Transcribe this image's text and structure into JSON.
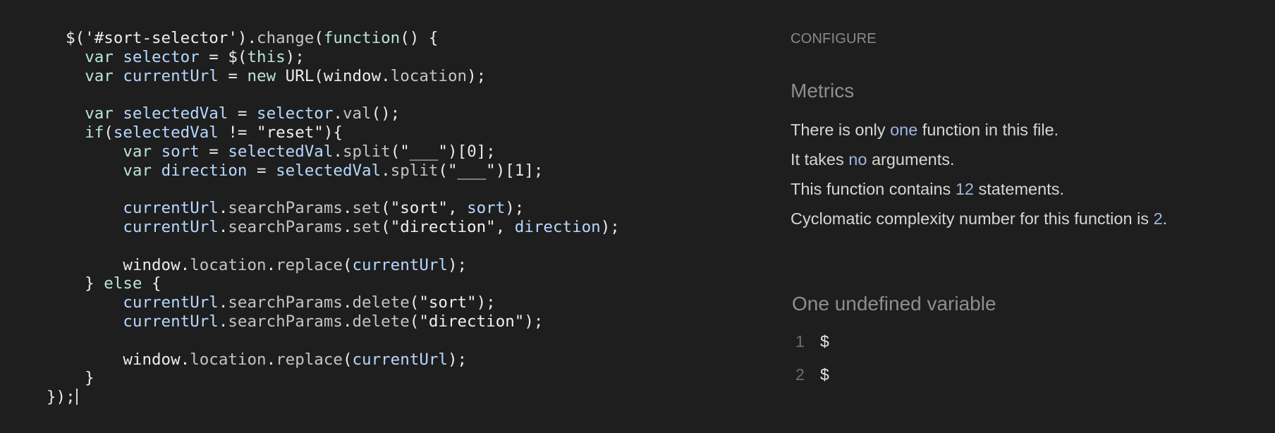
{
  "editor": {
    "lines": [
      [
        {
          "t": "  ",
          "c": "tok-default"
        },
        {
          "t": "$('#sort-selector')",
          "c": "tok-default"
        },
        {
          "t": ".",
          "c": "tok-default"
        },
        {
          "t": "change",
          "c": "tok-prop"
        },
        {
          "t": "(",
          "c": "tok-default"
        },
        {
          "t": "function",
          "c": "tok-kw"
        },
        {
          "t": "() {",
          "c": "tok-default"
        }
      ],
      [
        {
          "t": "    ",
          "c": "tok-default"
        },
        {
          "t": "var",
          "c": "tok-kw"
        },
        {
          "t": " ",
          "c": "tok-default"
        },
        {
          "t": "selector",
          "c": "tok-var"
        },
        {
          "t": " = $(",
          "c": "tok-default"
        },
        {
          "t": "this",
          "c": "tok-kw"
        },
        {
          "t": ");",
          "c": "tok-default"
        }
      ],
      [
        {
          "t": "    ",
          "c": "tok-default"
        },
        {
          "t": "var",
          "c": "tok-kw"
        },
        {
          "t": " ",
          "c": "tok-default"
        },
        {
          "t": "currentUrl",
          "c": "tok-var"
        },
        {
          "t": " = ",
          "c": "tok-default"
        },
        {
          "t": "new",
          "c": "tok-kw"
        },
        {
          "t": " URL(window.",
          "c": "tok-default"
        },
        {
          "t": "location",
          "c": "tok-prop"
        },
        {
          "t": ");",
          "c": "tok-default"
        }
      ],
      [
        {
          "t": "",
          "c": "tok-default"
        }
      ],
      [
        {
          "t": "    ",
          "c": "tok-default"
        },
        {
          "t": "var",
          "c": "tok-kw"
        },
        {
          "t": " ",
          "c": "tok-default"
        },
        {
          "t": "selectedVal",
          "c": "tok-var"
        },
        {
          "t": " = ",
          "c": "tok-default"
        },
        {
          "t": "selector",
          "c": "tok-var"
        },
        {
          "t": ".",
          "c": "tok-default"
        },
        {
          "t": "val",
          "c": "tok-prop"
        },
        {
          "t": "();",
          "c": "tok-default"
        }
      ],
      [
        {
          "t": "    ",
          "c": "tok-default"
        },
        {
          "t": "if",
          "c": "tok-kw"
        },
        {
          "t": "(",
          "c": "tok-default"
        },
        {
          "t": "selectedVal",
          "c": "tok-var"
        },
        {
          "t": " != ",
          "c": "tok-default"
        },
        {
          "t": "\"reset\"",
          "c": "tok-str"
        },
        {
          "t": "){",
          "c": "tok-default"
        }
      ],
      [
        {
          "t": "        ",
          "c": "tok-default"
        },
        {
          "t": "var",
          "c": "tok-kw"
        },
        {
          "t": " ",
          "c": "tok-default"
        },
        {
          "t": "sort",
          "c": "tok-var"
        },
        {
          "t": " = ",
          "c": "tok-default"
        },
        {
          "t": "selectedVal",
          "c": "tok-var"
        },
        {
          "t": ".",
          "c": "tok-default"
        },
        {
          "t": "split",
          "c": "tok-prop"
        },
        {
          "t": "(",
          "c": "tok-default"
        },
        {
          "t": "\"___\"",
          "c": "tok-str"
        },
        {
          "t": ")[",
          "c": "tok-default"
        },
        {
          "t": "0",
          "c": "tok-num"
        },
        {
          "t": "];",
          "c": "tok-default"
        }
      ],
      [
        {
          "t": "        ",
          "c": "tok-default"
        },
        {
          "t": "var",
          "c": "tok-kw"
        },
        {
          "t": " ",
          "c": "tok-default"
        },
        {
          "t": "direction",
          "c": "tok-var"
        },
        {
          "t": " = ",
          "c": "tok-default"
        },
        {
          "t": "selectedVal",
          "c": "tok-var"
        },
        {
          "t": ".",
          "c": "tok-default"
        },
        {
          "t": "split",
          "c": "tok-prop"
        },
        {
          "t": "(",
          "c": "tok-default"
        },
        {
          "t": "\"___\"",
          "c": "tok-str"
        },
        {
          "t": ")[",
          "c": "tok-default"
        },
        {
          "t": "1",
          "c": "tok-num"
        },
        {
          "t": "];",
          "c": "tok-default"
        }
      ],
      [
        {
          "t": "",
          "c": "tok-default"
        }
      ],
      [
        {
          "t": "        ",
          "c": "tok-default"
        },
        {
          "t": "currentUrl",
          "c": "tok-var"
        },
        {
          "t": ".",
          "c": "tok-default"
        },
        {
          "t": "searchParams",
          "c": "tok-prop"
        },
        {
          "t": ".",
          "c": "tok-default"
        },
        {
          "t": "set",
          "c": "tok-prop"
        },
        {
          "t": "(",
          "c": "tok-default"
        },
        {
          "t": "\"sort\"",
          "c": "tok-str"
        },
        {
          "t": ", ",
          "c": "tok-default"
        },
        {
          "t": "sort",
          "c": "tok-var"
        },
        {
          "t": ");",
          "c": "tok-default"
        }
      ],
      [
        {
          "t": "        ",
          "c": "tok-default"
        },
        {
          "t": "currentUrl",
          "c": "tok-var"
        },
        {
          "t": ".",
          "c": "tok-default"
        },
        {
          "t": "searchParams",
          "c": "tok-prop"
        },
        {
          "t": ".",
          "c": "tok-default"
        },
        {
          "t": "set",
          "c": "tok-prop"
        },
        {
          "t": "(",
          "c": "tok-default"
        },
        {
          "t": "\"direction\"",
          "c": "tok-str"
        },
        {
          "t": ", ",
          "c": "tok-default"
        },
        {
          "t": "direction",
          "c": "tok-var"
        },
        {
          "t": ");",
          "c": "tok-default"
        }
      ],
      [
        {
          "t": "",
          "c": "tok-default"
        }
      ],
      [
        {
          "t": "        window.",
          "c": "tok-default"
        },
        {
          "t": "location",
          "c": "tok-prop"
        },
        {
          "t": ".",
          "c": "tok-default"
        },
        {
          "t": "replace",
          "c": "tok-prop"
        },
        {
          "t": "(",
          "c": "tok-default"
        },
        {
          "t": "currentUrl",
          "c": "tok-var"
        },
        {
          "t": ");",
          "c": "tok-default"
        }
      ],
      [
        {
          "t": "    } ",
          "c": "tok-default"
        },
        {
          "t": "else",
          "c": "tok-kw"
        },
        {
          "t": " {",
          "c": "tok-default"
        }
      ],
      [
        {
          "t": "        ",
          "c": "tok-default"
        },
        {
          "t": "currentUrl",
          "c": "tok-var"
        },
        {
          "t": ".",
          "c": "tok-default"
        },
        {
          "t": "searchParams",
          "c": "tok-prop"
        },
        {
          "t": ".",
          "c": "tok-default"
        },
        {
          "t": "delete",
          "c": "tok-prop"
        },
        {
          "t": "(",
          "c": "tok-default"
        },
        {
          "t": "\"sort\"",
          "c": "tok-str"
        },
        {
          "t": ");",
          "c": "tok-default"
        }
      ],
      [
        {
          "t": "        ",
          "c": "tok-default"
        },
        {
          "t": "currentUrl",
          "c": "tok-var"
        },
        {
          "t": ".",
          "c": "tok-default"
        },
        {
          "t": "searchParams",
          "c": "tok-prop"
        },
        {
          "t": ".",
          "c": "tok-default"
        },
        {
          "t": "delete",
          "c": "tok-prop"
        },
        {
          "t": "(",
          "c": "tok-default"
        },
        {
          "t": "\"direction\"",
          "c": "tok-str"
        },
        {
          "t": ");",
          "c": "tok-default"
        }
      ],
      [
        {
          "t": "",
          "c": "tok-default"
        }
      ],
      [
        {
          "t": "        window.",
          "c": "tok-default"
        },
        {
          "t": "location",
          "c": "tok-prop"
        },
        {
          "t": ".",
          "c": "tok-default"
        },
        {
          "t": "replace",
          "c": "tok-prop"
        },
        {
          "t": "(",
          "c": "tok-default"
        },
        {
          "t": "currentUrl",
          "c": "tok-var"
        },
        {
          "t": ");",
          "c": "tok-default"
        }
      ],
      [
        {
          "t": "    }",
          "c": "tok-default"
        }
      ],
      [
        {
          "t": "});",
          "c": "tok-default"
        }
      ]
    ]
  },
  "panel": {
    "configure_label": "CONFIGURE",
    "metrics_title": "Metrics",
    "metrics": [
      {
        "before": "There is only ",
        "highlight": "one",
        "after": " function in this file."
      },
      {
        "before": "It takes ",
        "highlight": "no",
        "after": " arguments."
      },
      {
        "before": "This function contains ",
        "highlight": "12",
        "after": " statements."
      },
      {
        "before": "Cyclomatic complexity number for this function is ",
        "highlight": "2",
        "after": "."
      }
    ],
    "undefined_title": "One undefined variable",
    "undefined_items": [
      {
        "num": "1",
        "name": "$"
      },
      {
        "num": "2",
        "name": "$"
      }
    ]
  }
}
